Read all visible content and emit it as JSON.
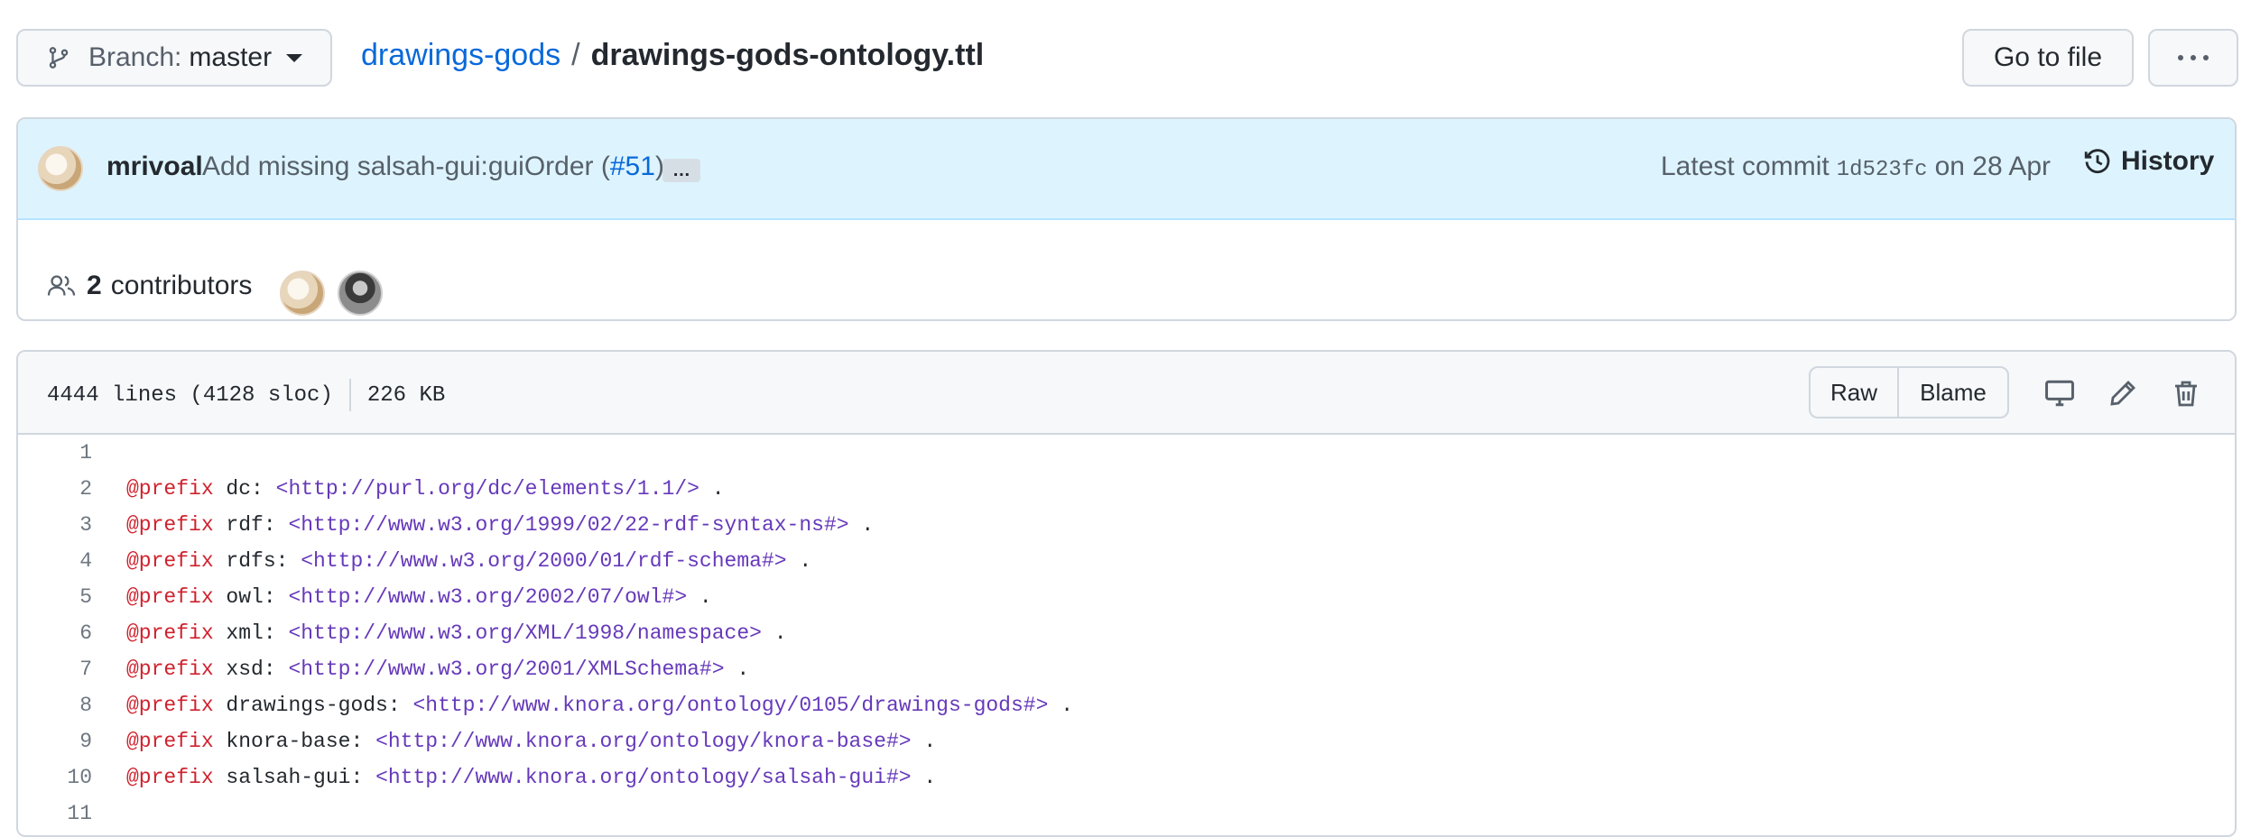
{
  "top_bar": {
    "branch_label": "Branch:",
    "branch_value": "master",
    "repo_name": "drawings-gods",
    "separator": "/",
    "file_name": "drawings-gods-ontology.ttl",
    "goto_file_label": "Go to file"
  },
  "commit": {
    "author": "mrivoal",
    "message_prefix": "Add missing salsah-gui:guiOrder (",
    "pr_link": "#51",
    "message_suffix": ")",
    "ellipsis": "…",
    "latest_label": "Latest commit",
    "sha": "1d523fc",
    "date": "on 28 Apr",
    "history_label": "History"
  },
  "contributors": {
    "count": "2",
    "label": "contributors"
  },
  "file_header": {
    "lines": "4444 lines (4128 sloc)",
    "size": "226 KB",
    "raw_label": "Raw",
    "blame_label": "Blame"
  },
  "code_lines": [
    {
      "n": "1",
      "kw": "",
      "pre": "",
      "iri": "",
      "post": ""
    },
    {
      "n": "2",
      "kw": "@prefix",
      "pre": " dc: ",
      "iri": "<http://purl.org/dc/elements/1.1/>",
      "post": " ."
    },
    {
      "n": "3",
      "kw": "@prefix",
      "pre": " rdf: ",
      "iri": "<http://www.w3.org/1999/02/22-rdf-syntax-ns#>",
      "post": " ."
    },
    {
      "n": "4",
      "kw": "@prefix",
      "pre": " rdfs: ",
      "iri": "<http://www.w3.org/2000/01/rdf-schema#>",
      "post": " ."
    },
    {
      "n": "5",
      "kw": "@prefix",
      "pre": " owl: ",
      "iri": "<http://www.w3.org/2002/07/owl#>",
      "post": " ."
    },
    {
      "n": "6",
      "kw": "@prefix",
      "pre": " xml: ",
      "iri": "<http://www.w3.org/XML/1998/namespace>",
      "post": " ."
    },
    {
      "n": "7",
      "kw": "@prefix",
      "pre": " xsd: ",
      "iri": "<http://www.w3.org/2001/XMLSchema#>",
      "post": " ."
    },
    {
      "n": "8",
      "kw": "@prefix",
      "pre": " drawings-gods: ",
      "iri": "<http://www.knora.org/ontology/0105/drawings-gods#>",
      "post": " ."
    },
    {
      "n": "9",
      "kw": "@prefix",
      "pre": " knora-base: ",
      "iri": "<http://www.knora.org/ontology/knora-base#>",
      "post": " ."
    },
    {
      "n": "10",
      "kw": "@prefix",
      "pre": " salsah-gui: ",
      "iri": "<http://www.knora.org/ontology/salsah-gui#>",
      "post": " ."
    },
    {
      "n": "11",
      "kw": "",
      "pre": "",
      "iri": "",
      "post": ""
    }
  ],
  "icons": {
    "branch": "git-branch-icon",
    "history": "history-icon",
    "people": "people-icon",
    "desktop": "desktop-icon",
    "edit": "pencil-icon",
    "delete": "trash-icon",
    "more": "kebab-horizontal-icon"
  },
  "colors": {
    "link": "#0969da",
    "keyword": "#cf222e",
    "iri": "#6639ba",
    "commit_bg": "#ddf4ff"
  }
}
